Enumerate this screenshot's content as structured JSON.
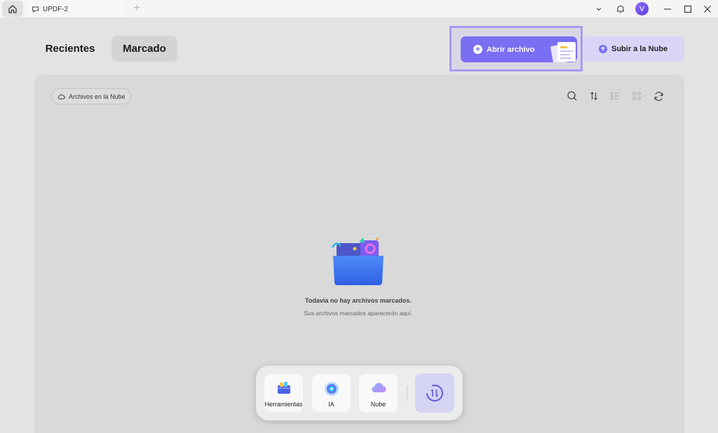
{
  "titlebar": {
    "tab_title": "UPDF-2",
    "new_tab": "+",
    "avatar_initial": "V"
  },
  "header": {
    "tabs": [
      {
        "label": "Recientes",
        "active": false
      },
      {
        "label": "Marcado",
        "active": true
      }
    ],
    "open_file_label": "Abrir archivo",
    "upload_cloud_label": "Subir a la Nube"
  },
  "panel": {
    "cloud_files_label": "Archivos en la Nube",
    "toolbar_icons": [
      "search-icon",
      "sort-icon",
      "list-view-icon",
      "grid-view-icon",
      "refresh-icon"
    ],
    "empty_title": "Todavía no hay archivos marcados.",
    "empty_subtitle": "Sus archivos marcados aparecerán aquí."
  },
  "dock": {
    "items": [
      {
        "label": "Herramientas",
        "icon": "toolbox-icon"
      },
      {
        "label": "IA",
        "icon": "ai-icon"
      },
      {
        "label": "Nube",
        "icon": "cloud-icon"
      }
    ],
    "sync_icon": "sync-icon"
  },
  "colors": {
    "accent": "#7a6ef2",
    "accent_light": "#d9d5f7",
    "highlight_border": "#a69bf3",
    "panel_bg": "#d9d9d9"
  }
}
